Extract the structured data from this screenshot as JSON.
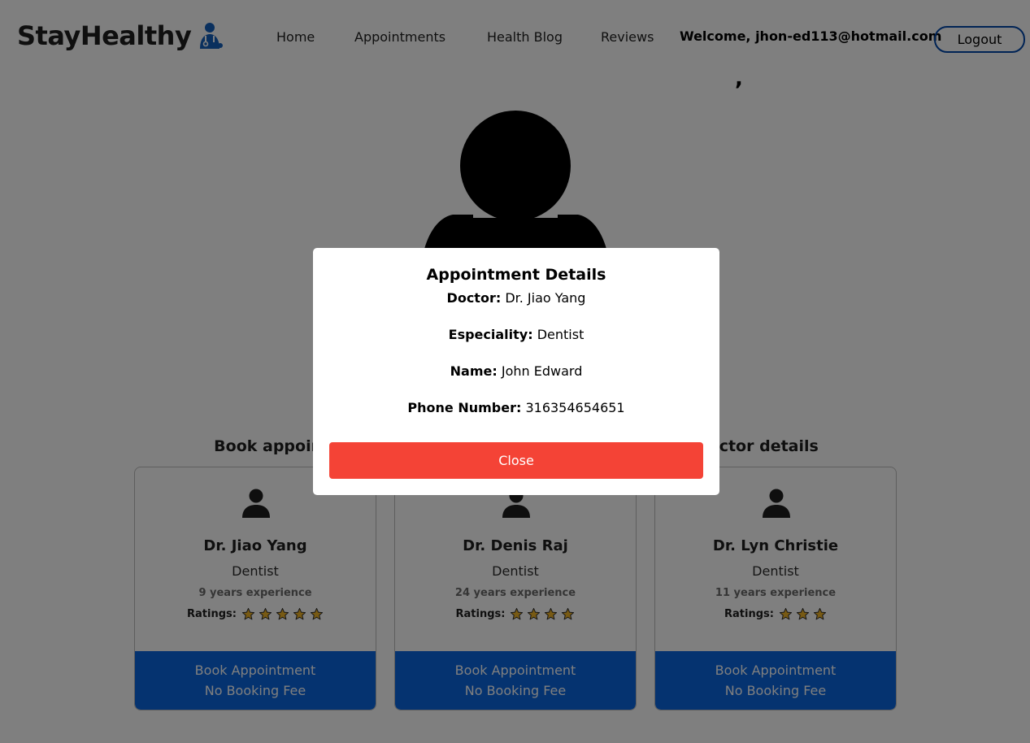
{
  "header": {
    "brand": "StayHealthy",
    "nav": [
      "Home",
      "Appointments",
      "Health Blog",
      "Reviews"
    ],
    "welcome": "Welcome, jhon-ed113@hotmail.com",
    "logout": "Logout"
  },
  "hero": {
    "title_fragment": ","
  },
  "section_title": "Book appointments with minimum wait-time & verified doctor details",
  "doctors": [
    {
      "name": "Dr. Jiao Yang",
      "speciality": "Dentist",
      "experience": "9 years experience",
      "ratings_label": "Ratings:",
      "rating": 5,
      "book_label": "Book Appointment",
      "fee_label": "No Booking Fee"
    },
    {
      "name": "Dr. Denis Raj",
      "speciality": "Dentist",
      "experience": "24 years experience",
      "ratings_label": "Ratings:",
      "rating": 4,
      "book_label": "Book Appointment",
      "fee_label": "No Booking Fee"
    },
    {
      "name": "Dr. Lyn Christie",
      "speciality": "Dentist",
      "experience": "11 years experience",
      "ratings_label": "Ratings:",
      "rating": 3,
      "book_label": "Book Appointment",
      "fee_label": "No Booking Fee"
    }
  ],
  "modal": {
    "title": "Appointment Details",
    "doctor_label": "Doctor:",
    "doctor_value": "Dr. Jiao Yang",
    "speciality_label": "Especiality:",
    "speciality_value": "Dentist",
    "name_label": "Name:",
    "name_value": "John Edward",
    "phone_label": "Phone Number:",
    "phone_value": "316354654651",
    "close": "Close"
  },
  "colors": {
    "primary": "#0a66e0",
    "close": "#f44336",
    "star": "#f0b429",
    "overlay": "rgba(0,0,0,0.5)"
  },
  "icons": {
    "brand": "doctor-icon",
    "hero": "doctor-avatar-icon",
    "card": "person-icon",
    "rating": "star-icon"
  }
}
